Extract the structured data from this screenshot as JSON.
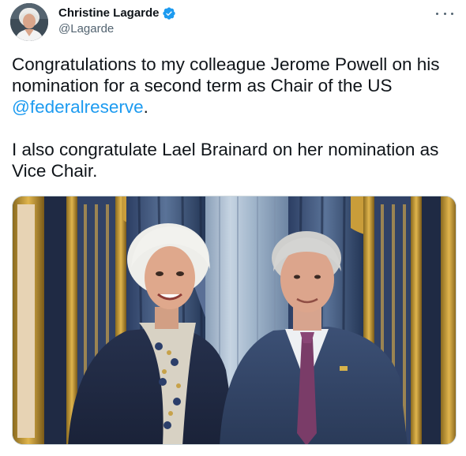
{
  "author": {
    "display_name": "Christine Lagarde",
    "handle": "@Lagarde",
    "verified": true,
    "avatar_icon": "profile-photo"
  },
  "menu": {
    "icon": "more-options-icon"
  },
  "tweet": {
    "line1_before": "Congratulations to my colleague Jerome Powell on his nomination for a second term as Chair of the US ",
    "mention": "@federalreserve",
    "line1_after": ".",
    "line2": "I also congratulate Lael Brainard on her nomination as Vice Chair."
  },
  "media": {
    "type": "photo"
  },
  "colors": {
    "text": "#0f1419",
    "secondary": "#536471",
    "link": "#1d9bf0",
    "verified": "#1d9bf0"
  }
}
